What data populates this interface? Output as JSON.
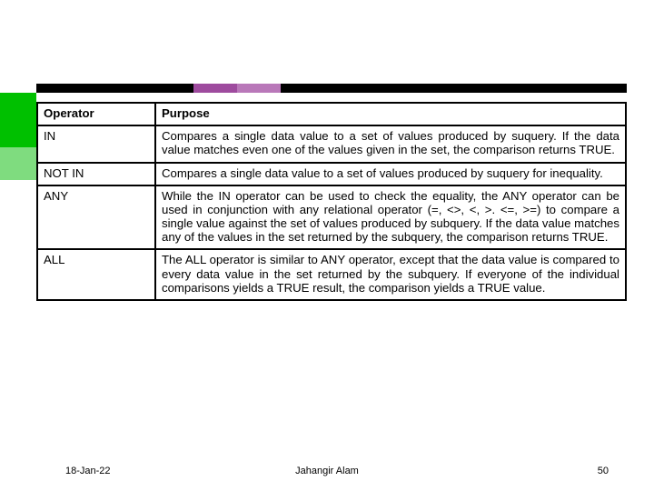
{
  "table": {
    "headers": {
      "col1": "Operator",
      "col2": "Purpose"
    },
    "rows": [
      {
        "op": "IN",
        "desc": "Compares a single data value to a set of values produced by suquery. If the data value matches even one of the values given in the set, the comparison returns TRUE."
      },
      {
        "op": "NOT IN",
        "desc": "Compares a single data value to a set of values produced by suquery for inequality."
      },
      {
        "op": "ANY",
        "desc": "While the IN operator can be used to check the equality, the ANY operator can be used in conjunction with any relational operator (=, <>, <, >. <=, >=) to compare a single value against the set of values produced by subquery. If the data value matches any of the values in the set returned by the subquery, the comparison returns TRUE."
      },
      {
        "op": "ALL",
        "desc": "The ALL operator is similar to ANY operator, except that the data value is compared to every data value in the set returned by the subquery. If everyone of the individual comparisons yields a TRUE result, the comparison yields a TRUE value."
      }
    ]
  },
  "footer": {
    "date": "18-Jan-22",
    "author": "Jahangir Alam",
    "page": "50"
  }
}
